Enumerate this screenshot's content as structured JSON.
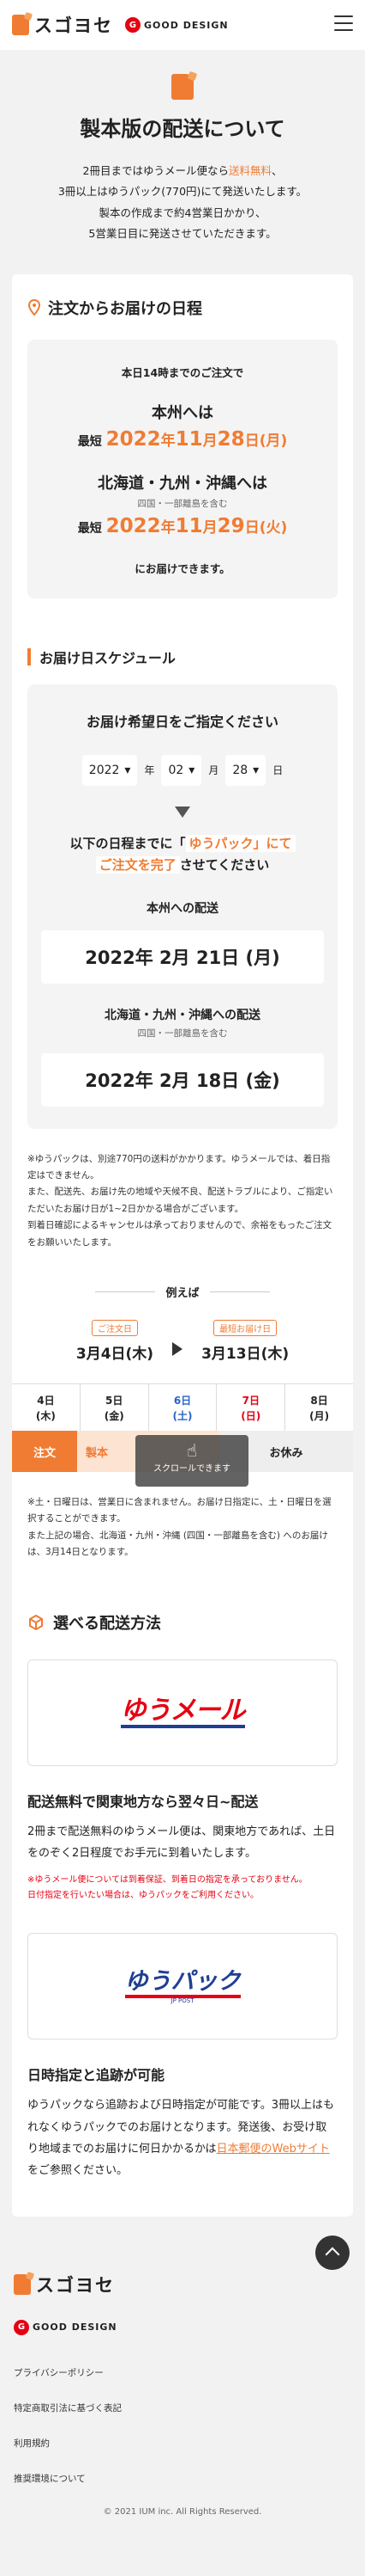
{
  "header": {
    "brand": "スゴヨセ",
    "gd_label": "GOOD DESIGN",
    "gd_mark": "G"
  },
  "hero": {
    "title": "製本版の配送について",
    "line1_pre": "2冊目までは",
    "line1_mid": "ゆうメール便なら",
    "line1_accent": "送料無料",
    "line1_post": "、",
    "line2": "3冊以上はゆうパック(770円)にて発送いたします。",
    "line3": "製本の作成まで約4営業日かかり、",
    "line4": "5営業日目に発送させていただきます。"
  },
  "order_section": {
    "title": "注文からお届けの日程",
    "intro": "本日14時までのご注文で",
    "honshu": "本州へは",
    "saitan": "最短",
    "honshu_year": "2022",
    "honshu_month": "11",
    "honshu_day": "28",
    "honshu_dow": "(月)",
    "remote": "北海道・九州・沖縄へは",
    "remote_note": "四国・一部離島を含む",
    "remote_year": "2022",
    "remote_month": "11",
    "remote_day": "29",
    "remote_dow": "(火)",
    "outro": "にお届けできます。",
    "u_year": "年",
    "u_month": "月",
    "u_day": "日"
  },
  "schedule": {
    "title": "お届け日スケジュール",
    "prompt": "お届け希望日をご指定ください",
    "year_value": "2022",
    "year_unit": "年",
    "month_value": "02",
    "month_unit": "月",
    "day_value": "28",
    "day_unit": "日",
    "cta_pre": "以下の日程までに「",
    "cta_accent": "ゆうパック」にて",
    "cta_accent2": "ご注文を完了",
    "cta_post": "させてください",
    "honshu_label": "本州への配送",
    "honshu_date": "2022年 2月 21日 (月)",
    "remote_label": "北海道・九州・沖縄への配送",
    "remote_note": "四国・一部離島を含む",
    "remote_date": "2022年 2月 18日 (金)",
    "fine1": "※ゆうパックは、別途770円の送料がかかります。ゆうメールでは、着日指定はできません。",
    "fine2": "また、配送先、お届け先の地域や天候不良、配送トラブルにより、ご指定いただいたお届け日が1~2日かかる場合がございます。",
    "fine3": "到着日確認によるキャンセルは承っておりませんので、余裕をもったご注文をお願いいたします。"
  },
  "example": {
    "title": "例えば",
    "tag1": "ご注文日",
    "date1": "3月4日(木)",
    "tag2": "最短お届け日",
    "date2": "3月13日(木)",
    "days": [
      {
        "label": "4日",
        "dow": "(木)",
        "tone": ""
      },
      {
        "label": "5日",
        "dow": "(金)",
        "tone": ""
      },
      {
        "label": "6日",
        "dow": "(土)",
        "tone": "blue"
      },
      {
        "label": "7日",
        "dow": "(日)",
        "tone": "red"
      },
      {
        "label": "8日",
        "dow": "(月)",
        "tone": ""
      }
    ],
    "flow_start": "注文",
    "flow_mid": "製本",
    "flow_end": "お休み",
    "scroll_hint": "スクロールできます",
    "hand": "☝",
    "fine1": "※土・日曜日は、営業日に含まれません。お届け日指定に、土・日曜日を選択することができます。",
    "fine2": "また上記の場合、北海道・九州・沖縄 (四国・一部離島を含む) へのお届けは、3月14日となります。"
  },
  "methods": {
    "title": "選べる配送方法",
    "yumail_logo": "ゆうメール",
    "yumail_title": "配送無料で関東地方なら翌々日~配送",
    "yumail_body": "2冊まで配送無料のゆうメール便は、関東地方であれば、土日をのぞく2日程度でお手元に到着いたします。",
    "yumail_warn1": "※ゆうメール便については到着保証、到着日の指定を承っておりません。",
    "yumail_warn2": "日付指定を行いたい場合は、ゆうパックをご利用ください。",
    "yupack_logo": "ゆうパック",
    "yupack_sub": "JP POST",
    "yupack_title": "日時指定と追跡が可能",
    "yupack_body": "ゆうパックなら追跡および日時指定が可能です。3冊以上はもれなくゆうパックでのお届けとなります。発送後、お受け取り地域までのお届けに何日かかるかは",
    "yupack_link": "日本郵便のWebサイト",
    "yupack_body2": "をご参照ください。"
  },
  "footer": {
    "brand": "スゴヨセ",
    "gd_label": "GOOD DESIGN",
    "gd_mark": "G",
    "links": [
      "プライバシーポリシー",
      "特定商取引法に基づく表記",
      "利用規約",
      "推奨環境について"
    ],
    "copyright": "© 2021 IUM inc. All Rights Reserved."
  },
  "colors": {
    "accent": "#f07c34",
    "red": "#e60012",
    "navy": "#1f3f93",
    "blue": "#2a64c8"
  }
}
